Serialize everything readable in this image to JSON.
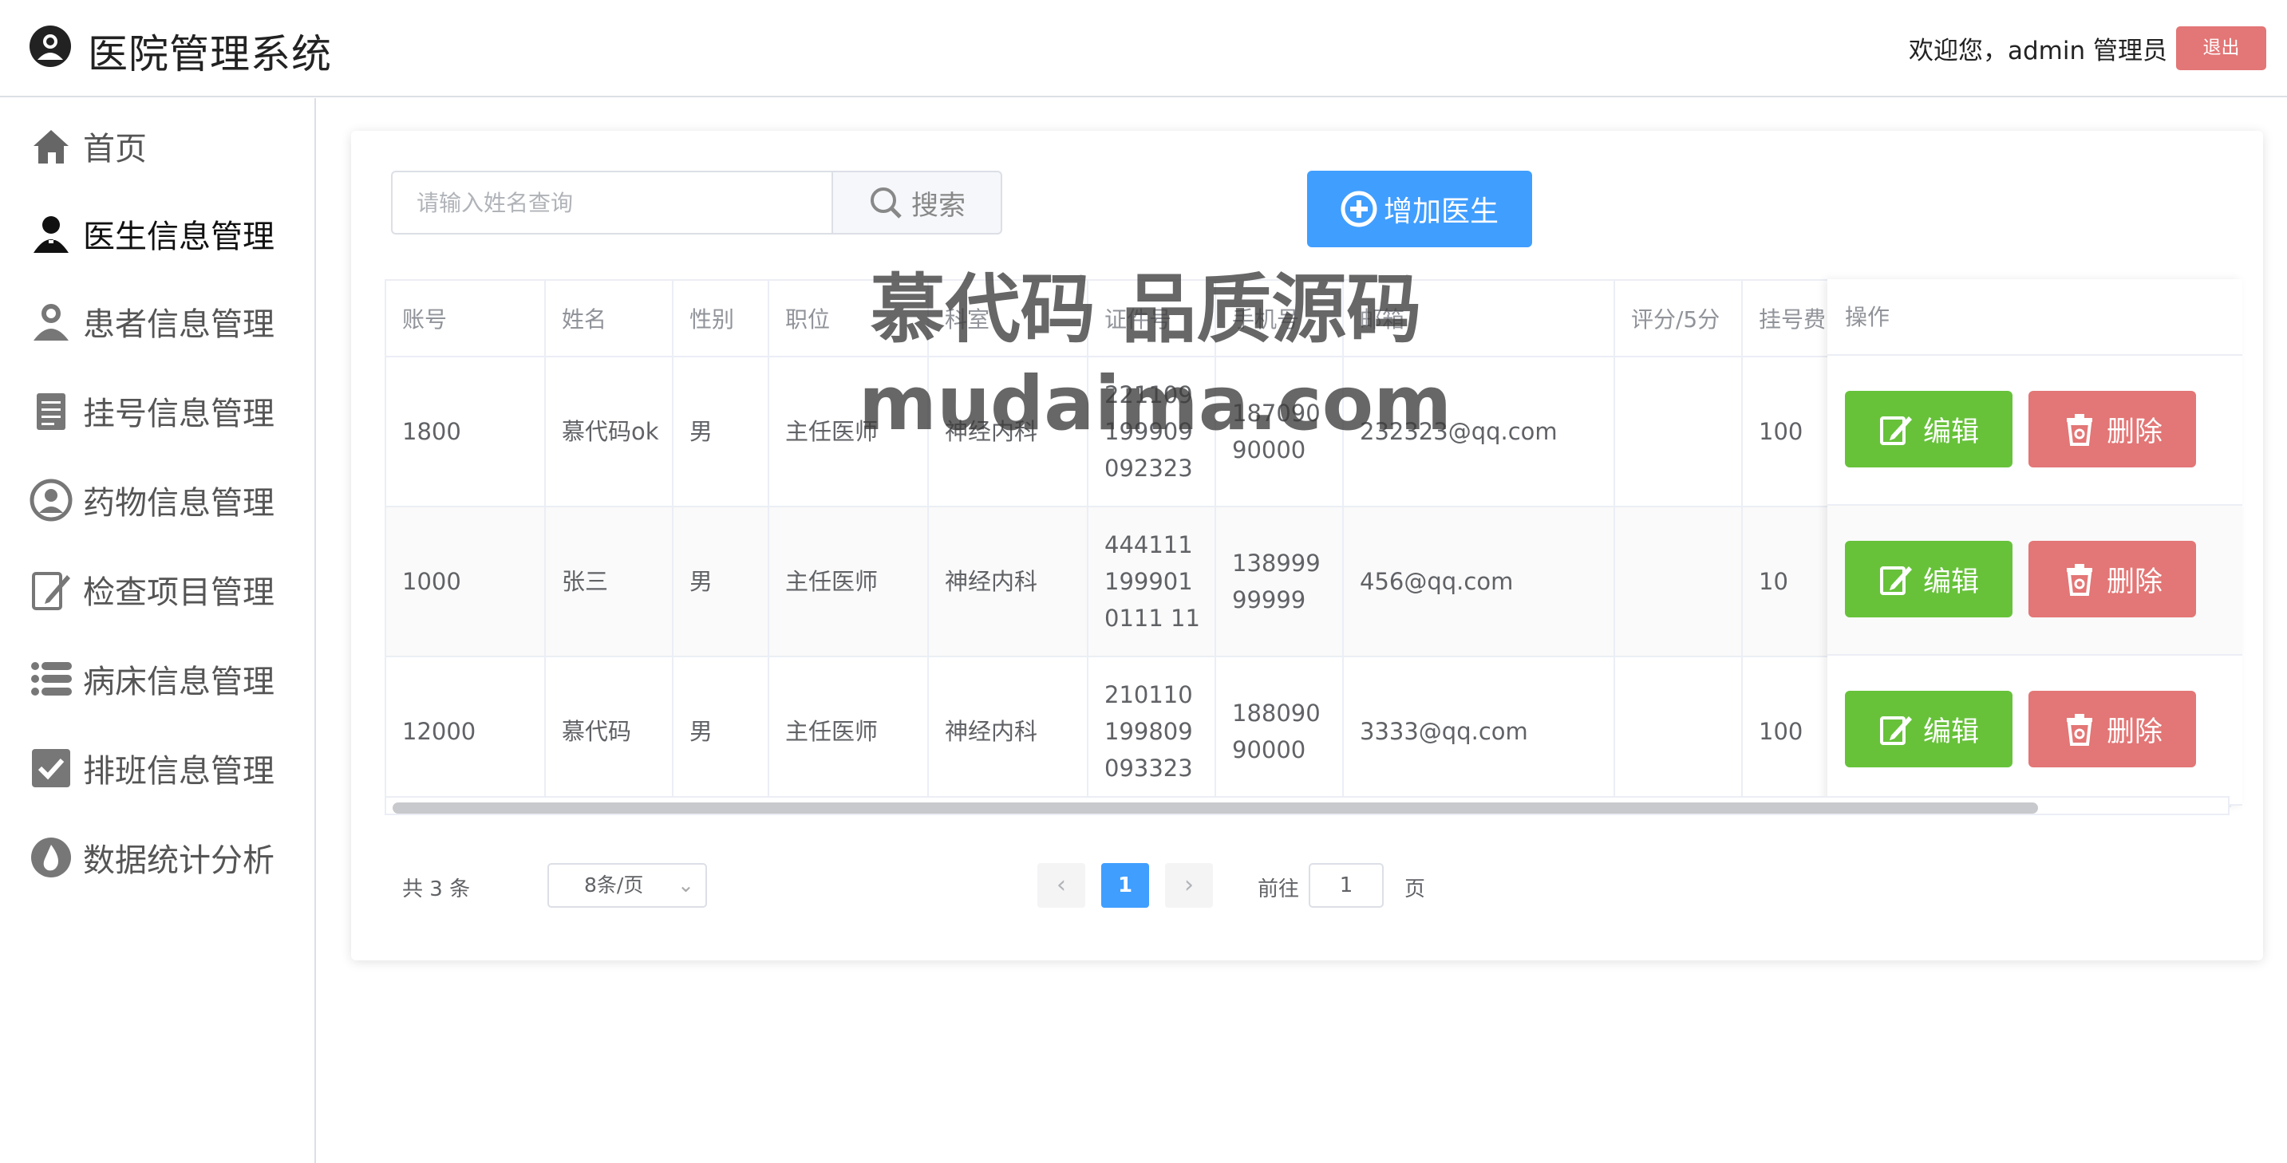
{
  "header": {
    "app_title": "医院管理系统",
    "welcome": "欢迎您，admin 管理员",
    "logout_label": "退出"
  },
  "sidebar": {
    "items": [
      {
        "label": "首页",
        "icon": "home-icon"
      },
      {
        "label": "医生信息管理",
        "icon": "doctor-icon",
        "active": true
      },
      {
        "label": "患者信息管理",
        "icon": "patient-icon"
      },
      {
        "label": "挂号信息管理",
        "icon": "clipboard-icon"
      },
      {
        "label": "药物信息管理",
        "icon": "medicine-icon"
      },
      {
        "label": "检查项目管理",
        "icon": "edit-document-icon"
      },
      {
        "label": "病床信息管理",
        "icon": "list-icon"
      },
      {
        "label": "排班信息管理",
        "icon": "checkbox-icon"
      },
      {
        "label": "数据统计分析",
        "icon": "drop-icon"
      }
    ]
  },
  "toolbar": {
    "search_placeholder": "请输入姓名查询",
    "search_label": "搜索",
    "add_label": "增加医生"
  },
  "table": {
    "columns": [
      "账号",
      "姓名",
      "性别",
      "职位",
      "科室",
      "证件号",
      "手机号",
      "邮箱",
      "评分/5分",
      "挂号费",
      "操作"
    ],
    "rows": [
      {
        "account": "1800",
        "name": "慕代码ok",
        "gender": "男",
        "position": "主任医师",
        "dept": "神经内科",
        "id_no": "221109199909092323",
        "phone": "18709090000",
        "email": "232323@qq.com",
        "score": "",
        "fee": "100"
      },
      {
        "account": "1000",
        "name": "张三",
        "gender": "男",
        "position": "主任医师",
        "dept": "神经内科",
        "id_no": "4441111999010111 11",
        "phone": "13899999999",
        "email": "456@qq.com",
        "score": "",
        "fee": "10"
      },
      {
        "account": "12000",
        "name": "慕代码",
        "gender": "男",
        "position": "主任医师",
        "dept": "神经内科",
        "id_no": "210110199809093323",
        "phone": "18809090000",
        "email": "3333@qq.com",
        "score": "",
        "fee": "100"
      }
    ],
    "edit_label": "编辑",
    "delete_label": "删除"
  },
  "pagination": {
    "total": "共 3 条",
    "page_size": "8条/页",
    "current_page": "1",
    "goto_label": "前往",
    "goto_value": "1",
    "goto_suffix": "页"
  },
  "watermark": {
    "line1": "慕代码 品质源码",
    "line2": "mudaima.com"
  },
  "colors": {
    "primary": "#409eff",
    "success": "#67c23a",
    "danger": "#e37676"
  }
}
